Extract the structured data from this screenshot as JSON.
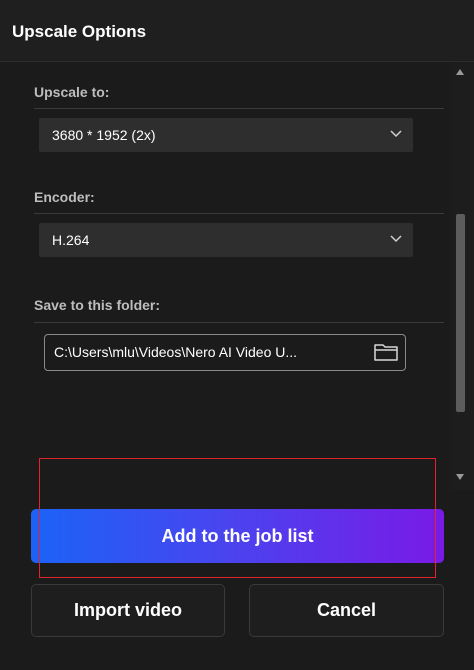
{
  "header": {
    "title": "Upscale Options"
  },
  "upscale": {
    "label": "Upscale to:",
    "value": "3680 * 1952 (2x)",
    "icon": "chevron-down-icon"
  },
  "encoder": {
    "label": "Encoder:",
    "value": "H.264",
    "icon": "chevron-down-icon"
  },
  "save_folder": {
    "label": "Save to this folder:",
    "path": "C:\\Users\\mlu\\Videos\\Nero AI Video U...",
    "icon": "folder-icon"
  },
  "actions": {
    "add_to_job_list": "Add to the job list",
    "import_video": "Import video",
    "cancel": "Cancel"
  },
  "colors": {
    "accent_gradient_start": "#1b63f6",
    "accent_gradient_end": "#7a1ae6",
    "highlight_outline": "#e0242c",
    "background": "#1b1b1b"
  }
}
